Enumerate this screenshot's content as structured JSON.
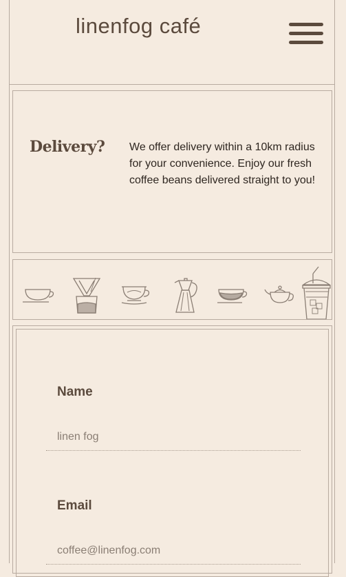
{
  "header": {
    "brand": "linenfog café",
    "menu_icon": "hamburger-menu-icon"
  },
  "delivery": {
    "title": "Delivery?",
    "text": "We offer delivery within a 10km radius for your convenience. Enjoy our fresh coffee beans delivered straight to you!"
  },
  "icons_strip": {
    "icons": [
      "teacup-icon",
      "pour-over-dripper-icon",
      "cappuccino-cup-icon",
      "moka-pot-icon",
      "coffee-cup-icon",
      "teapot-icon",
      "iced-coffee-cup-icon"
    ]
  },
  "form": {
    "name_label": "Name",
    "name_placeholder": "linen fog",
    "email_label": "Email",
    "email_placeholder": "coffee@linenfog.com"
  },
  "colors": {
    "background": "#f5ebe0",
    "text": "#5b4a3d",
    "border": "#b7aaa0"
  }
}
